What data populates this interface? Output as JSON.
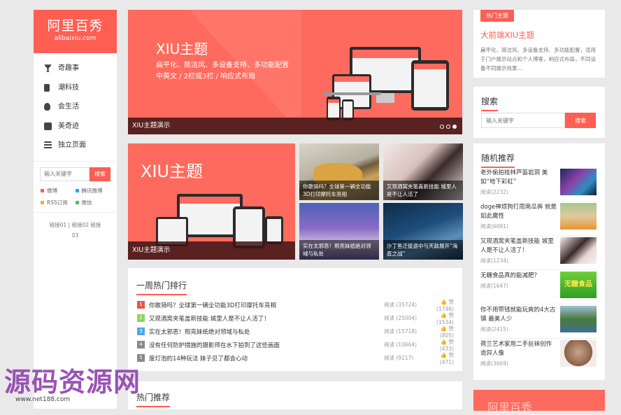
{
  "logo": {
    "title": "阿里百秀",
    "subtitle": "alibaixiu.com"
  },
  "nav": [
    {
      "label": "奇趣事",
      "icon": "cocktail-icon"
    },
    {
      "label": "潮科技",
      "icon": "mobile-icon"
    },
    {
      "label": "会生活",
      "icon": "fire-icon"
    },
    {
      "label": "美奇迹",
      "icon": "gift-icon"
    },
    {
      "label": "独立页面",
      "icon": "list-icon"
    }
  ],
  "sidebar_search": {
    "placeholder": "输入关键字",
    "button": "搜索"
  },
  "social": [
    {
      "label": "微博",
      "color": "#ff5e52"
    },
    {
      "label": "腾讯微博",
      "color": "#2fa9e2"
    },
    {
      "label": "RSS订阅",
      "color": "#f5b031"
    },
    {
      "label": "微信",
      "color": "#5cb85c"
    }
  ],
  "sidebar_links": "链接01 | 链接02 链接03",
  "slider": {
    "title": "XIU主题",
    "desc1": "扁平化、简洁风、多设备支持、多功能配置",
    "desc2": "中英文 / 2栏或3栏 / 响应式布局",
    "caption": "XIU主题演示"
  },
  "feature": {
    "big_title": "XIU主题",
    "big_caption": "XIU主题演示",
    "tiles": [
      {
        "caption": "你敢骑吗？全球第一辆全功能3D打印摩托车亮相"
      },
      {
        "caption": "又现酒窝夹笔盖新技能 城里人是不让人活了"
      },
      {
        "caption": "实在太邪恶！照亮妹纸绝对领域与私处"
      },
      {
        "caption": "沙丁鱼迁徙途中与天敌展开“海底之战”"
      }
    ]
  },
  "weekly_hot": {
    "title": "一周热门排行",
    "items": [
      {
        "rank": "1",
        "color": "#e8554b",
        "title": "你敢骑吗？全球第一辆全功能3D打印摩托车亮相",
        "reads": "阅读 (35724)",
        "likes": "赞 (1746)"
      },
      {
        "rank": "2",
        "color": "#8fd35e",
        "title": "又现酒窝夹笔盖新技能 城里人是不让人活了！",
        "reads": "阅读 (25004)",
        "likes": "赞 (1534)"
      },
      {
        "rank": "3",
        "color": "#4ca7e8",
        "title": "实在太邪恶！照亮妹纸绝对领域与私处",
        "reads": "阅读 (15718)",
        "likes": "赞 (805)"
      },
      {
        "rank": "4",
        "color": "#888888",
        "title": "没有任何防护措施的摄影师在水下拍到了这些画面",
        "reads": "阅读 (10664)",
        "likes": "赞 (433)"
      },
      {
        "rank": "5",
        "color": "#888888",
        "title": "废灯泡的14种玩法 妹子见了都会心动",
        "reads": "阅读 (9217)",
        "likes": "赞 (471)"
      }
    ]
  },
  "hot_recommend": {
    "title": "热门推荐"
  },
  "right_hot": {
    "label": "热门主题",
    "title": "大前端XIU主题",
    "desc": "扁平化、简洁风、多设备支持、多功能配置，适用于门户展示站点和个人博客，响应式布局，不同设备不同展示效果..."
  },
  "right_search": {
    "title": "搜索",
    "placeholder": "输入关键字",
    "button": "搜索"
  },
  "random": {
    "title": "随机推荐",
    "items": [
      {
        "title": "老外偷拍桂林芦笛岩洞 美如“地下彩虹”",
        "reads": "阅读(2232)",
        "thumb": "cave"
      },
      {
        "title": "doge神烦狗打周南瓜裤 就是如此魔性",
        "reads": "阅读(6091)",
        "thumb": "doge"
      },
      {
        "title": "又现酒窝夹笔盖新技能 城里人是不让人活了！",
        "reads": "阅读(1234)",
        "thumb": "girl"
      },
      {
        "title": "无糖食品真的能减肥？",
        "reads": "阅读(1647)",
        "thumb": "food"
      },
      {
        "title": "你不用带钱就能玩爽的4大古镇 最美人少",
        "reads": "阅读(2415)",
        "thumb": "town"
      },
      {
        "title": "荷兰艺术家用二手丝袜创作诡异人像",
        "reads": "阅读(3669)",
        "thumb": "portrait"
      }
    ]
  },
  "random_food_label": "无糖食品",
  "right_bottom": "阿里百秀",
  "watermark": {
    "text": "源码资源网",
    "url": "www.net188.com"
  }
}
